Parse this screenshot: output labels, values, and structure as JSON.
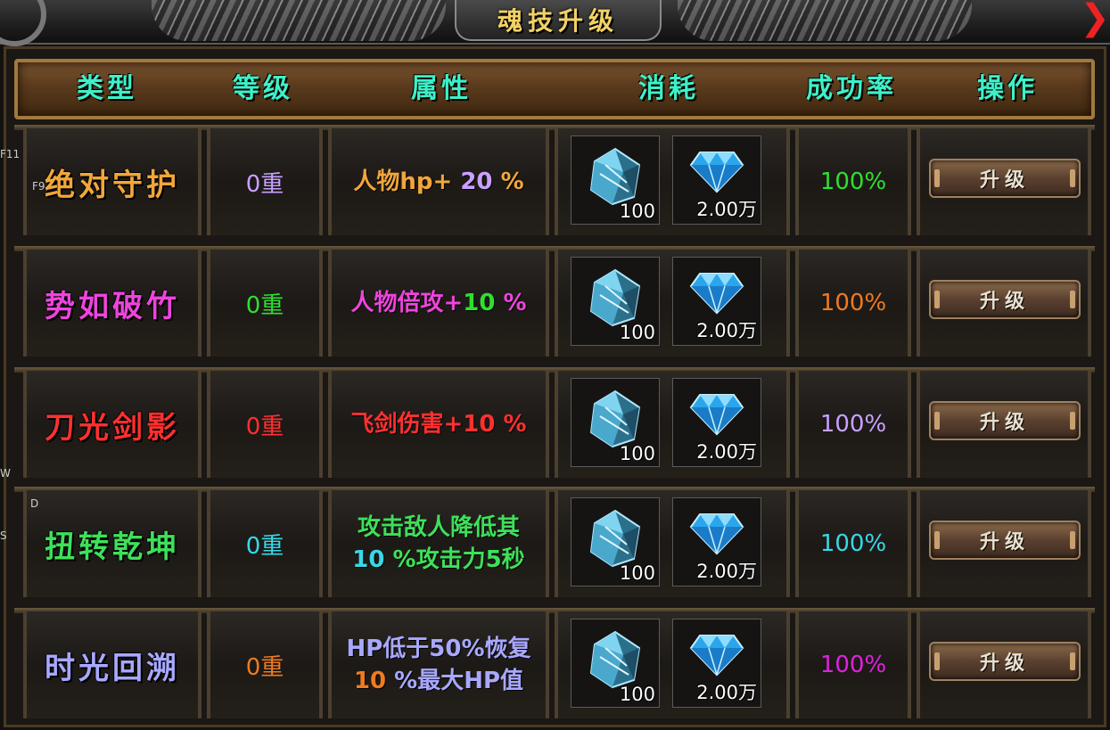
{
  "window": {
    "title": "魂技升级"
  },
  "hotkeys": [
    "F11",
    "F9",
    "W",
    "D",
    "S"
  ],
  "columns": [
    "类型",
    "等级",
    "属性",
    "消耗",
    "成功率",
    "操作"
  ],
  "rows": [
    {
      "name": "绝对守护",
      "name_color": "#f2a63a",
      "level": "0重",
      "level_color": "#c9a0ff",
      "attr_line1_a": "人物hp+",
      "attr_line1_num": " 20 ",
      "attr_line1_b": " %",
      "attr_line2_a": "",
      "attr_line2_num": "",
      "attr_line2_b": "",
      "attr_color": "#f2a63a",
      "attr_num_color": "#c9a0ff",
      "cost_crystal": "100",
      "cost_diamond": "2.00万",
      "rate": "100%",
      "rate_color": "#2ee02e",
      "button": "升级"
    },
    {
      "name": "势如破竹",
      "name_color": "#ee44dd",
      "level": "0重",
      "level_color": "#2ee02e",
      "attr_line1_a": "人物倍攻+",
      "attr_line1_num": "10",
      "attr_line1_b": " %",
      "attr_line2_a": "",
      "attr_line2_num": "",
      "attr_line2_b": "",
      "attr_color": "#ee44dd",
      "attr_num_color": "#2ee02e",
      "cost_crystal": "100",
      "cost_diamond": "2.00万",
      "rate": "100%",
      "rate_color": "#f07a20",
      "button": "升级"
    },
    {
      "name": "刀光剑影",
      "name_color": "#ff3030",
      "level": "0重",
      "level_color": "#ff3030",
      "attr_line1_a": "飞剑伤害+",
      "attr_line1_num": "10",
      "attr_line1_b": " %",
      "attr_line2_a": "",
      "attr_line2_num": "",
      "attr_line2_b": "",
      "attr_color": "#ff3030",
      "attr_num_color": "#ff3030",
      "cost_crystal": "100",
      "cost_diamond": "2.00万",
      "rate": "100%",
      "rate_color": "#c9a0ff",
      "button": "升级"
    },
    {
      "name": "扭转乾坤",
      "name_color": "#3ee05a",
      "level": "0重",
      "level_color": "#38d8e8",
      "attr_line1_a": "攻击敌人降低其",
      "attr_line1_num": "",
      "attr_line1_b": "",
      "attr_line2_a": "",
      "attr_line2_num": "10 ",
      "attr_line2_b": " %攻击力5秒",
      "attr_color": "#3ee05a",
      "attr_num_color": "#38d8e8",
      "cost_crystal": "100",
      "cost_diamond": "2.00万",
      "rate": "100%",
      "rate_color": "#38d8e8",
      "button": "升级"
    },
    {
      "name": "时光回溯",
      "name_color": "#a8a8ff",
      "level": "0重",
      "level_color": "#f07a20",
      "attr_line1_a": "HP低于50%恢复",
      "attr_line1_num": "",
      "attr_line1_b": "",
      "attr_line2_a": "",
      "attr_line2_num": "10 ",
      "attr_line2_b": " %最大HP值",
      "attr_color": "#a8a8ff",
      "attr_num_color": "#f07a20",
      "cost_crystal": "100",
      "cost_diamond": "2.00万",
      "rate": "100%",
      "rate_color": "#e020e0",
      "button": "升级"
    }
  ]
}
